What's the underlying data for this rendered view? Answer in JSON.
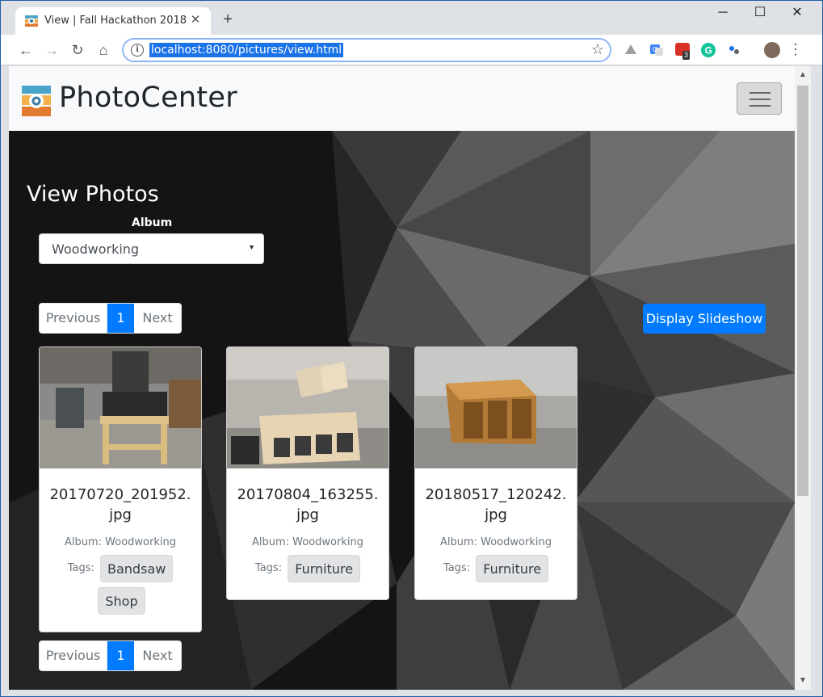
{
  "browser": {
    "tab_title": "View | Fall Hackathon 2018",
    "tab_close": "✕",
    "new_tab": "+",
    "url": "localhost:8080/pictures/view.html",
    "extension_badge": "3",
    "window_controls": {
      "minimize": "─",
      "maximize": "☐",
      "close": "✕"
    }
  },
  "navbar": {
    "brand": "PhotoCenter"
  },
  "page": {
    "title": "View Photos",
    "album_label": "Album",
    "album_selected": "Woodworking",
    "pagination": {
      "previous": "Previous",
      "current": "1",
      "next": "Next"
    },
    "slideshow_button": "Display Slideshow"
  },
  "photos": [
    {
      "filename": "20170720_201952.jpg",
      "album_prefix": "Album:",
      "album": "Woodworking",
      "tags_label": "Tags:",
      "tags": [
        "Bandsaw",
        "Shop"
      ]
    },
    {
      "filename": "20170804_163255.jpg",
      "album_prefix": "Album:",
      "album": "Woodworking",
      "tags_label": "Tags:",
      "tags": [
        "Furniture"
      ]
    },
    {
      "filename": "20180517_120242.jpg",
      "album_prefix": "Album:",
      "album": "Woodworking",
      "tags_label": "Tags:",
      "tags": [
        "Furniture"
      ]
    }
  ]
}
